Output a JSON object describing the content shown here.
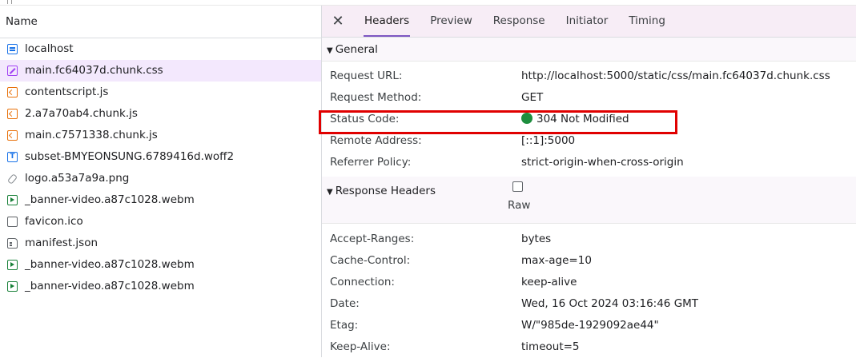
{
  "left_panel": {
    "header": "Name",
    "files": [
      {
        "name": "localhost",
        "icon": "document-icon",
        "selected": false
      },
      {
        "name": "main.fc64037d.chunk.css",
        "icon": "stylesheet-icon",
        "selected": true
      },
      {
        "name": "contentscript.js",
        "icon": "script-icon",
        "selected": false
      },
      {
        "name": "2.a7a70ab4.chunk.js",
        "icon": "script-icon",
        "selected": false
      },
      {
        "name": "main.c7571338.chunk.js",
        "icon": "script-icon",
        "selected": false
      },
      {
        "name": "subset-BMYEONSUNG.6789416d.woff2",
        "icon": "font-icon",
        "selected": false
      },
      {
        "name": "logo.a53a7a9a.png",
        "icon": "image-icon",
        "selected": false
      },
      {
        "name": "_banner-video.a87c1028.webm",
        "icon": "media-icon",
        "selected": false
      },
      {
        "name": "favicon.ico",
        "icon": "other-file-icon",
        "selected": false
      },
      {
        "name": "manifest.json",
        "icon": "manifest-icon",
        "selected": false
      },
      {
        "name": "_banner-video.a87c1028.webm",
        "icon": "media-icon",
        "selected": false
      },
      {
        "name": "_banner-video.a87c1028.webm",
        "icon": "media-icon",
        "selected": false
      }
    ]
  },
  "tabs": {
    "close": "✕",
    "items": [
      "Headers",
      "Preview",
      "Response",
      "Initiator",
      "Timing"
    ],
    "active": "Headers"
  },
  "general": {
    "title": "General",
    "request_url_label": "Request URL:",
    "request_url": "http://localhost:5000/static/css/main.fc64037d.chunk.css",
    "request_method_label": "Request Method:",
    "request_method": "GET",
    "status_code_label": "Status Code:",
    "status_code": "304 Not Modified",
    "status_color": "#1e8e3e",
    "remote_address_label": "Remote Address:",
    "remote_address": "[::1]:5000",
    "referrer_policy_label": "Referrer Policy:",
    "referrer_policy": "strict-origin-when-cross-origin"
  },
  "response_headers": {
    "title": "Response Headers",
    "raw_label": "Raw",
    "raw_checked": false,
    "items": [
      {
        "key": "Accept-Ranges:",
        "value": "bytes"
      },
      {
        "key": "Cache-Control:",
        "value": "max-age=10"
      },
      {
        "key": "Connection:",
        "value": "keep-alive"
      },
      {
        "key": "Date:",
        "value": "Wed, 16 Oct 2024 03:16:46 GMT"
      },
      {
        "key": "Etag:",
        "value": "W/\"985de-1929092ae44\""
      },
      {
        "key": "Keep-Alive:",
        "value": "timeout=5"
      }
    ]
  },
  "theme": {
    "accent": "#7e57c2",
    "selected_row": "#f3e8fd",
    "highlight": "#e00000"
  }
}
